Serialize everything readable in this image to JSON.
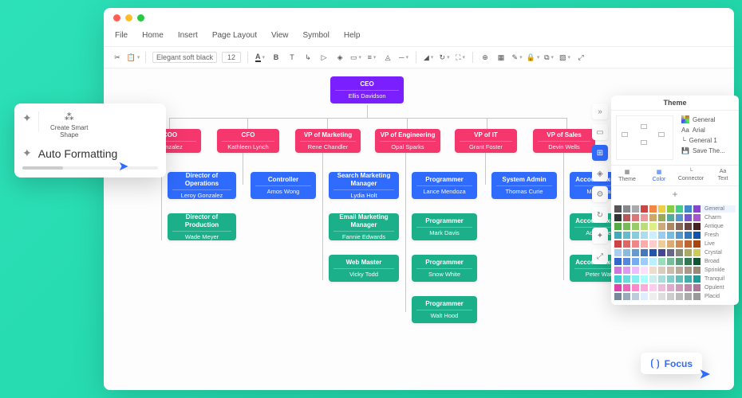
{
  "menu": {
    "file": "File",
    "home": "Home",
    "insert": "Insert",
    "page": "Page Layout",
    "view": "View",
    "symbol": "Symbol",
    "help": "Help"
  },
  "toolbar": {
    "font": "Elegant soft black",
    "size": "12"
  },
  "org": {
    "ceo": {
      "role": "CEO",
      "name": "Ellis Davidson"
    },
    "row2": [
      {
        "role": "COO",
        "name": "Gonzalez"
      },
      {
        "role": "CFO",
        "name": "Kathleen Lynch"
      },
      {
        "role": "VP of Marketing",
        "name": "Rene Chandler"
      },
      {
        "role": "VP of Engineering",
        "name": "Opal Sparks"
      },
      {
        "role": "VP of IT",
        "name": "Grant Foster"
      },
      {
        "role": "VP of Sales",
        "name": "Devin Wells"
      }
    ],
    "b1": {
      "role": "Director of Operations",
      "name": "Leroy Gonzalez"
    },
    "b2": {
      "role": "Controller",
      "name": "Amos Wong"
    },
    "b3": {
      "role": "Search Marketing Manager",
      "name": "Lydia Holt"
    },
    "b4": {
      "role": "Programmer",
      "name": "Lance Mendoza"
    },
    "b5": {
      "role": "System Admin",
      "name": "Thomas Curie"
    },
    "b6": {
      "role": "Account Executive",
      "name": "Marie Pascal"
    },
    "g1": {
      "role": "Director of Production",
      "name": "Wade Meyer"
    },
    "g2": {
      "role": "Email Marketing Manager",
      "name": "Fannie Edwards"
    },
    "g3": {
      "role": "Programmer",
      "name": "Mark Davis"
    },
    "g4": {
      "role": "Account Executive",
      "name": "Ada Lovelace"
    },
    "g5": {
      "role": "Web Master",
      "name": "Vicky Todd"
    },
    "g6": {
      "role": "Programmer",
      "name": "Snow White"
    },
    "g7": {
      "role": "Account Executive",
      "name": "Peter Watkins"
    },
    "g8": {
      "role": "Programmer",
      "name": "Walt Hood"
    }
  },
  "popout": {
    "create": "Create Smart Shape",
    "auto": "Auto Formatting"
  },
  "theme": {
    "title": "Theme",
    "opts": {
      "general": "General",
      "font": "Arial",
      "g1": "General 1",
      "save": "Save The..."
    },
    "tabs": {
      "theme": "Theme",
      "color": "Color",
      "connector": "Connector",
      "text": "Text"
    },
    "rows": [
      "General",
      "Charm",
      "Antique",
      "Fresh",
      "Live",
      "Crystal",
      "Broad",
      "Sprinkle",
      "Tranquil",
      "Opulent",
      "Placid"
    ]
  },
  "focus": "Focus"
}
